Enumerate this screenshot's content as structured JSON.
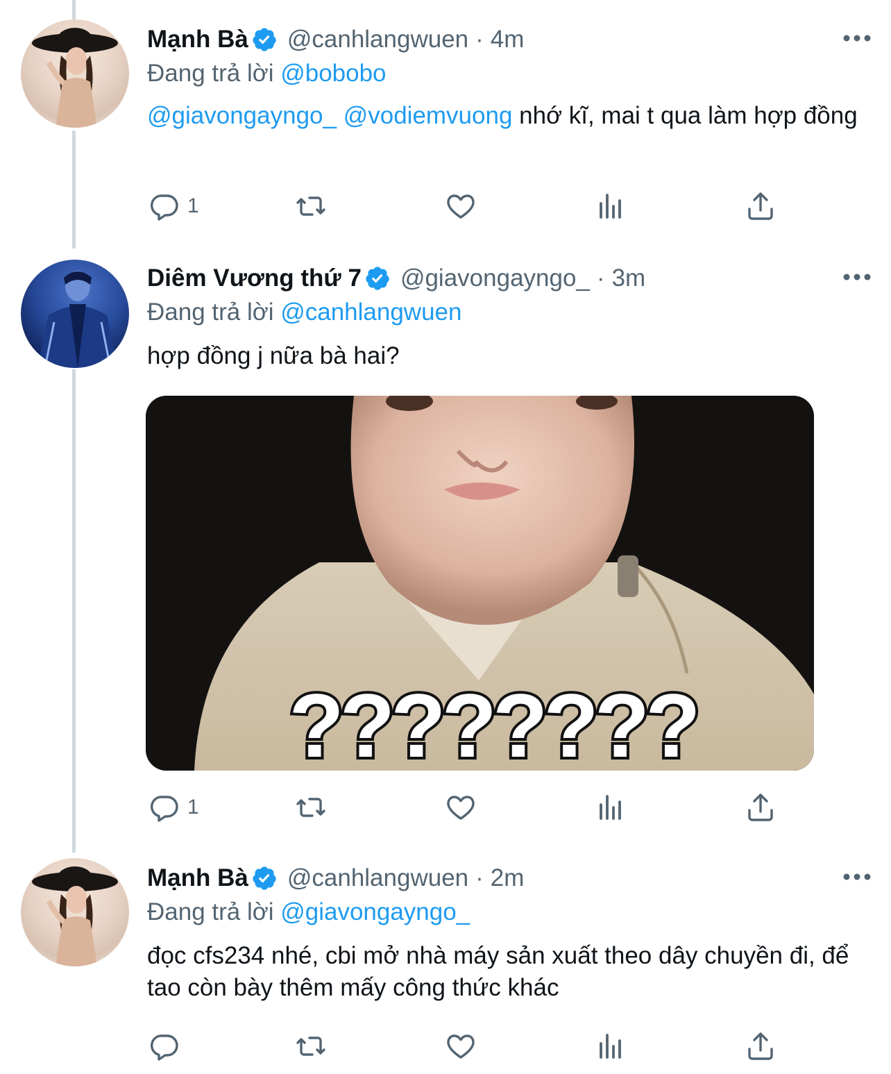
{
  "colors": {
    "accent": "#1d9bf0",
    "secondary": "#536471",
    "text": "#0f1419",
    "thread": "#cfd9de"
  },
  "tweets": [
    {
      "name": "Mạnh Bà",
      "handle": "@canhlangwuen",
      "dot": "·",
      "time": "4m",
      "replying_prefix": "Đang trả lời ",
      "replying_to": "@bobobo",
      "mention1": "@giavongayngo_",
      "mention2": "@vodiemvuong",
      "body": " nhớ kĩ, mai t qua làm hợp đồng",
      "reply_count": "1",
      "avatar_icon": "avatar-woman",
      "verified_icon": "verified-badge-icon"
    },
    {
      "name": "Diêm Vương thứ 7",
      "handle": "@giavongayngo_",
      "dot": "·",
      "time": "3m",
      "replying_prefix": "Đang trả lời ",
      "replying_to": "@canhlangwuen",
      "body": "hợp đồng j nữa bà hai?",
      "media_caption": "????????",
      "reply_count": "1",
      "avatar_icon": "avatar-man",
      "verified_icon": "verified-badge-icon"
    },
    {
      "name": "Mạnh Bà",
      "handle": "@canhlangwuen",
      "dot": "·",
      "time": "2m",
      "replying_prefix": "Đang trả lời ",
      "replying_to": "@giavongayngo_",
      "body": "đọc cfs234 nhé, cbi mở nhà máy sản xuất theo dây chuyền đi, để tao còn bày thêm mấy công thức khác",
      "reply_count": "",
      "avatar_icon": "avatar-woman",
      "verified_icon": "verified-badge-icon"
    }
  ]
}
